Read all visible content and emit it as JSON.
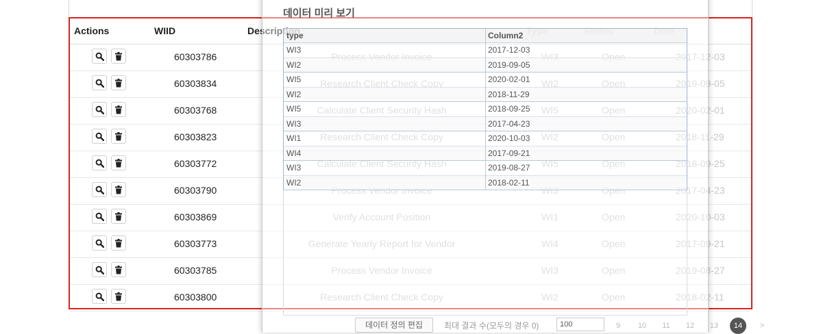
{
  "table": {
    "headers": {
      "actions": "Actions",
      "wiid": "WIID",
      "description": "Description",
      "type": "Type",
      "status": "Status",
      "date": "Date"
    },
    "rows": [
      {
        "wiid": "60303786",
        "description": "Process Vendor Invoice",
        "type": "WI3",
        "status": "Open",
        "date": "2017-12-03"
      },
      {
        "wiid": "60303834",
        "description": "Research Client Check Copy",
        "type": "WI2",
        "status": "Open",
        "date": "2019-09-05"
      },
      {
        "wiid": "60303768",
        "description": "Calculate Client Security Hash",
        "type": "WI5",
        "status": "Open",
        "date": "2020-02-01"
      },
      {
        "wiid": "60303823",
        "description": "Research Client Check Copy",
        "type": "WI2",
        "status": "Open",
        "date": "2018-11-29"
      },
      {
        "wiid": "60303772",
        "description": "Calculate Client Security Hash",
        "type": "WI5",
        "status": "Open",
        "date": "2018-09-25"
      },
      {
        "wiid": "60303790",
        "description": "Process Vendor Invoice",
        "type": "WI3",
        "status": "Open",
        "date": "2017-04-23"
      },
      {
        "wiid": "60303869",
        "description": "Verify Account Position",
        "type": "WI1",
        "status": "Open",
        "date": "2020-10-03"
      },
      {
        "wiid": "60303773",
        "description": "Generate Yearly Report for Vendor",
        "type": "WI4",
        "status": "Open",
        "date": "2017-09-21"
      },
      {
        "wiid": "60303785",
        "description": "Process Vendor Invoice",
        "type": "WI3",
        "status": "Open",
        "date": "2019-08-27"
      },
      {
        "wiid": "60303800",
        "description": "Research Client Check Copy",
        "type": "WI2",
        "status": "Open",
        "date": "2018-02-11"
      }
    ],
    "row_icons": [
      "search-icon",
      "trash-icon"
    ]
  },
  "modal": {
    "title": "데이터 미리 보기",
    "preview": {
      "columns": [
        "type",
        "Column2"
      ],
      "rows": [
        [
          "WI3",
          "2017-12-03"
        ],
        [
          "WI2",
          "2019-09-05"
        ],
        [
          "WI5",
          "2020-02-01"
        ],
        [
          "WI2",
          "2018-11-29"
        ],
        [
          "WI5",
          "2018-09-25"
        ],
        [
          "WI3",
          "2017-04-23"
        ],
        [
          "WI1",
          "2020-10-03"
        ],
        [
          "WI4",
          "2017-09-21"
        ],
        [
          "WI3",
          "2019-08-27"
        ],
        [
          "WI2",
          "2018-02-11"
        ]
      ]
    },
    "footer": {
      "edit_button": "데이터 정의 편집",
      "max_results_text": "최대 결과 수(모두의 경우 0)",
      "max_results_value": "100",
      "pages": [
        "9",
        "10",
        "11",
        "12",
        "13",
        "14",
        ">"
      ],
      "active_page": "14"
    }
  },
  "colors": {
    "selection_border": "#d9211d",
    "preview_border": "#9fb3cc",
    "faded_text": "#c7c7c7"
  }
}
